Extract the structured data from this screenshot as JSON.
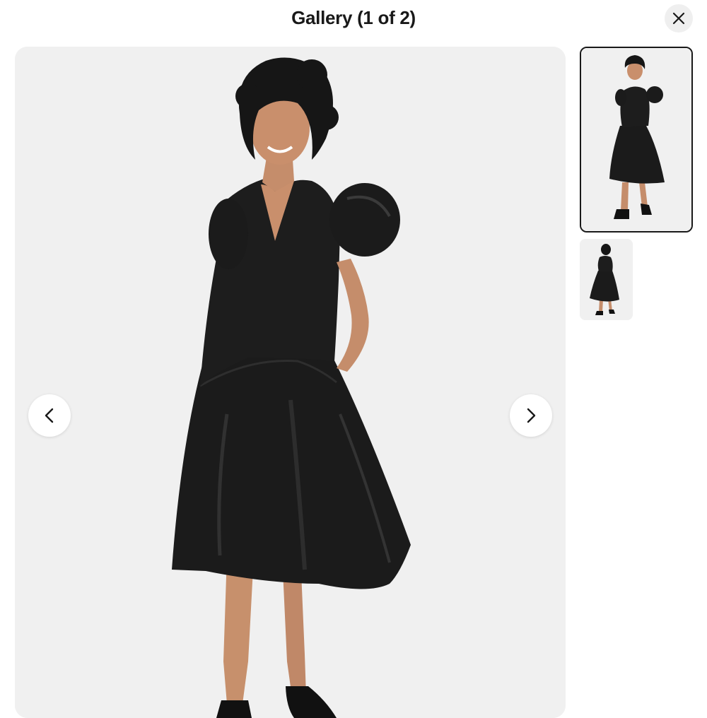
{
  "header": {
    "title": "Gallery (1 of 2)",
    "close_icon": "close-icon"
  },
  "gallery": {
    "current_index": 1,
    "total": 2,
    "main_image": {
      "subject": "model-in-black-tiered-midi-dress"
    },
    "prev_icon": "chevron-left-icon",
    "next_icon": "chevron-right-icon",
    "thumbnails": [
      {
        "subject": "front-view",
        "selected": true
      },
      {
        "subject": "back-view",
        "selected": false
      }
    ]
  },
  "colors": {
    "background": "#ffffff",
    "image_bg": "#f0f0f0",
    "text": "#191919",
    "dress": "#1b1b1b",
    "close_button_bg": "#efefef"
  }
}
